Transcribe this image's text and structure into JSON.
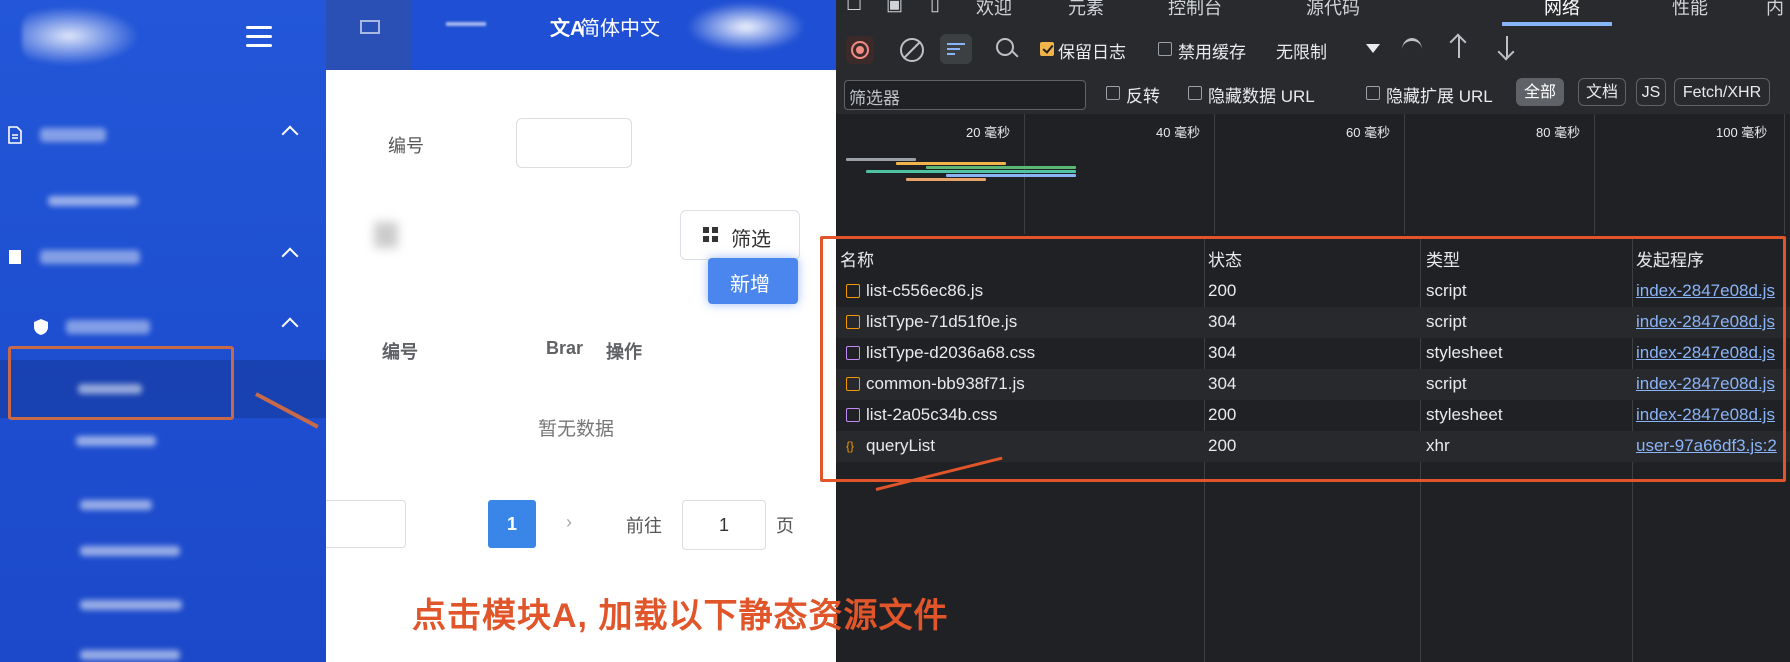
{
  "app": {
    "header": {
      "lang_icon": "文A",
      "lang_label": "简体中文"
    },
    "form": {
      "number_label": "编号",
      "filter_button": "筛选",
      "add_button": "新增"
    },
    "table": {
      "columns": [
        "编号",
        "Brar",
        "操作"
      ],
      "empty_text": "暂无数据"
    },
    "pager": {
      "current_page": "1",
      "next_arrow": "›",
      "goto_label": "前往",
      "goto_value": "1",
      "page_suffix": "页"
    },
    "annotation": "点击模块A, 加载以下静态资源文件"
  },
  "devtools": {
    "tabs": [
      "欢迎",
      "元素",
      "控制台",
      "源代码",
      "网络",
      "性能",
      "内"
    ],
    "active_tab": "网络",
    "toolbar": {
      "preserve_log": "保留日志",
      "preserve_log_checked": true,
      "disable_cache": "禁用缓存",
      "disable_cache_checked": false,
      "throttle": "无限制"
    },
    "filterbar": {
      "filter_placeholder": "筛选器",
      "invert": "反转",
      "hide_data_urls": "隐藏数据 URL",
      "hide_extension_urls": "隐藏扩展 URL",
      "types": [
        "全部",
        "文档",
        "JS",
        "Fetch/XHR"
      ],
      "active_type": "全部"
    },
    "overview": {
      "ticks": [
        "20 毫秒",
        "40 毫秒",
        "60 毫秒",
        "80 毫秒",
        "100 毫秒"
      ]
    },
    "table": {
      "headers": [
        "名称",
        "状态",
        "类型",
        "发起程序"
      ],
      "rows": [
        {
          "name": "list-c556ec86.js",
          "status": "200",
          "type": "script",
          "initiator": "index-2847e08d.js",
          "icon": "script-icon"
        },
        {
          "name": "listType-71d51f0e.js",
          "status": "304",
          "type": "script",
          "initiator": "index-2847e08d.js",
          "icon": "script-icon"
        },
        {
          "name": "listType-d2036a68.css",
          "status": "304",
          "type": "stylesheet",
          "initiator": "index-2847e08d.js",
          "icon": "stylesheet-icon"
        },
        {
          "name": "common-bb938f71.js",
          "status": "304",
          "type": "script",
          "initiator": "index-2847e08d.js",
          "icon": "script-icon"
        },
        {
          "name": "list-2a05c34b.css",
          "status": "200",
          "type": "stylesheet",
          "initiator": "index-2847e08d.js",
          "icon": "stylesheet-icon"
        },
        {
          "name": "queryList",
          "status": "200",
          "type": "xhr",
          "initiator": "user-97a66df3.js:2",
          "icon": "xhr-icon"
        }
      ]
    }
  },
  "colors": {
    "sidebar_blue": "#1e4fd1",
    "annotation_red": "#e0552a",
    "devtools_bg": "#202124",
    "link_blue": "#8ab4f8"
  }
}
